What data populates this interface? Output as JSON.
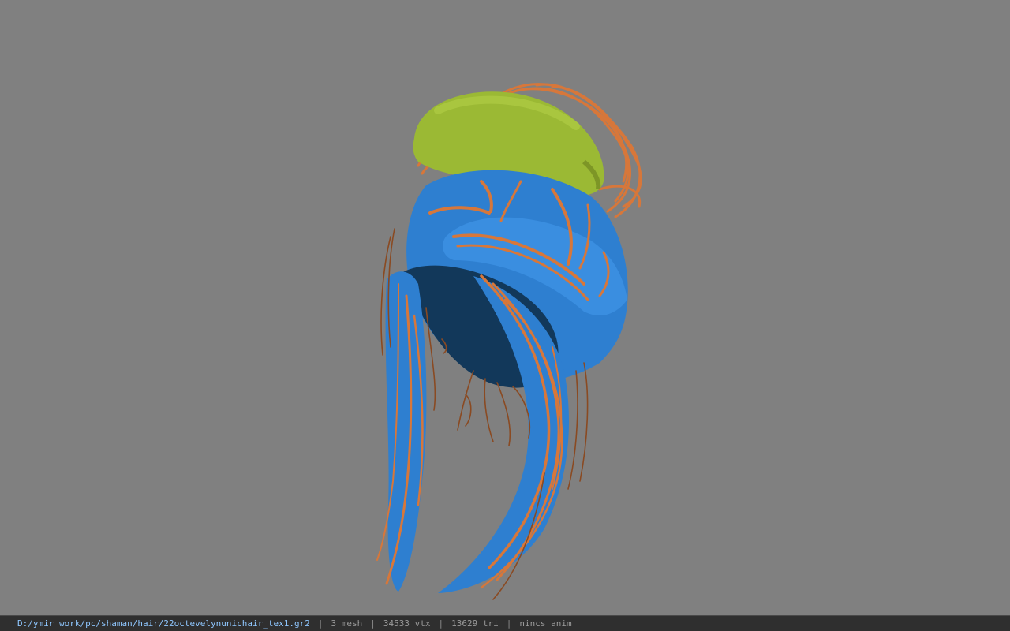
{
  "viewport": {
    "background": "#808080",
    "colors": {
      "hair_blue": "#2e7fd0",
      "hair_blue_dark": "#12385a",
      "hair_orange": "#d7773a",
      "hair_brown": "#8a4a22",
      "headband_green": "#9bb934"
    }
  },
  "statusbar": {
    "path": "D:/ymir work/pc/shaman/hair/22octevelynunichair_tex1.gr2",
    "separator": "|",
    "mesh": "3 mesh",
    "vertices": "34533 vtx",
    "triangles": "13629 tri",
    "anim": "nincs anim"
  }
}
